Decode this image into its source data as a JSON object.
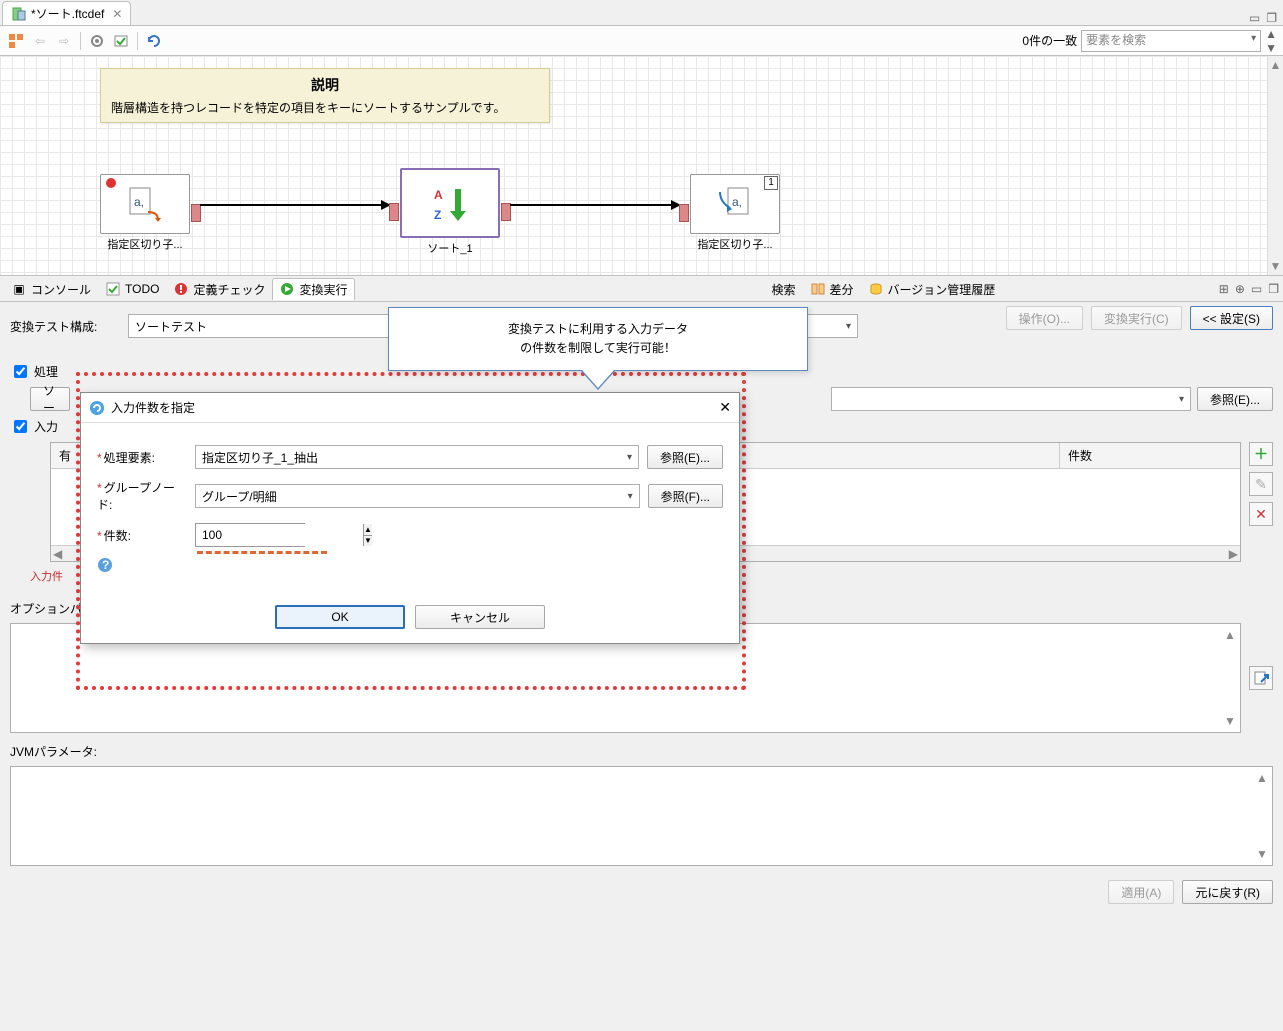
{
  "tab": {
    "title": "*ソート.ftcdef"
  },
  "toolbar": {
    "match_count": "0件の一致",
    "search_placeholder": "要素を検索"
  },
  "canvas": {
    "note_title": "説明",
    "note_body": "階層構造を持つレコードを特定の項目をキーにソートするサンプルです。",
    "node1_label": "指定区切り子...",
    "node2_label": "ソート_1",
    "node3_label": "指定区切り子...",
    "node3_badge": "1"
  },
  "views": {
    "tabs": [
      "コンソール",
      "TODO",
      "定義チェック",
      "変換実行",
      "検索",
      "差分",
      "バージョン管理履歴"
    ]
  },
  "settings": {
    "config_label": "変換テスト構成:",
    "config_value": "ソートテスト",
    "btn_ops": "操作(O)...",
    "btn_run": "変換実行(C)",
    "btn_settings": "<<  設定(S)",
    "chk_process_label": "処理",
    "sort_prefix": "ソー",
    "chk_input_label": "入力",
    "browse": "参照(E)...",
    "browse_combo_right": "参照(E)...",
    "table_col1": "有",
    "table_col2": "件数",
    "err": "入力件",
    "opt_label": "オプションパラメータ:",
    "jvm_label": "JVMパラメータ:",
    "btn_apply": "適用(A)",
    "btn_revert": "元に戻す(R)"
  },
  "dialog": {
    "title": "入力件数を指定",
    "proc_label": "処理要素:",
    "proc_value": "指定区切り子_1_抽出",
    "group_label": "グループノード:",
    "group_value": "グループ/明細",
    "count_label": "件数:",
    "count_value": "100",
    "browse_e": "参照(E)...",
    "browse_f": "参照(F)...",
    "ok": "OK",
    "cancel": "キャンセル"
  },
  "callout": {
    "line1": "変換テストに利用する入力データ",
    "line2": "の件数を制限して実行可能！"
  }
}
